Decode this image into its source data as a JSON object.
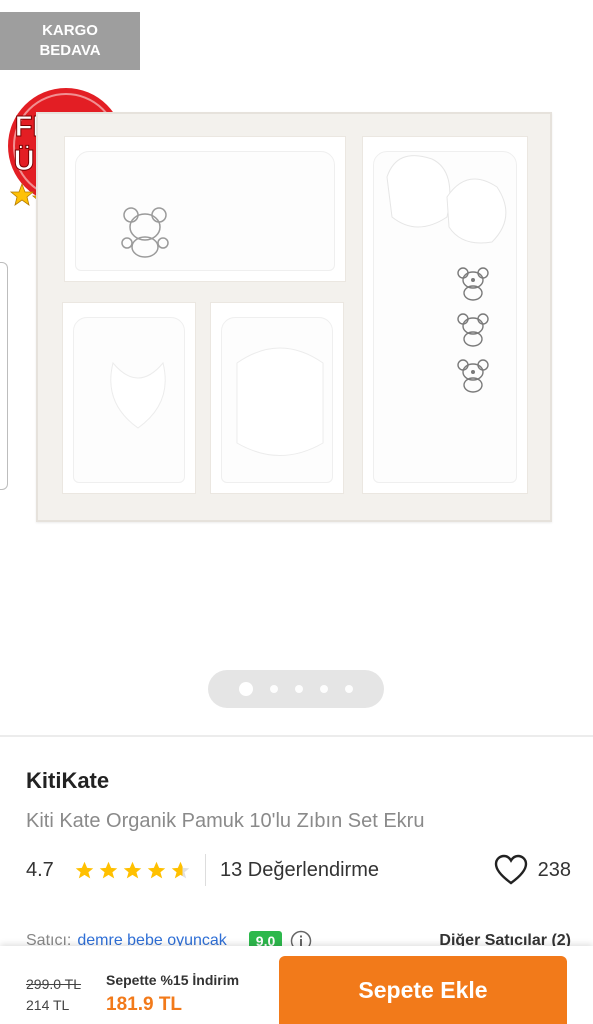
{
  "gallery": {
    "cargo_badge_line1": "KARGO",
    "cargo_badge_line2": "BEDAVA",
    "promo_badge_line1": "FIRSAT",
    "promo_badge_line2": "ÜRÜNÜ",
    "promo_badge_color": "#e31e24",
    "image_count": 5,
    "active_image_index": 0
  },
  "product": {
    "brand": "KitiKate",
    "name": "Kiti Kate Organik Pamuk 10'lu Zıbın Set Ekru",
    "rating": "4.7",
    "rating_value": 4.7,
    "review_count": "13 Değerlendirme",
    "favorite_count": "238"
  },
  "seller": {
    "label": "Satıcı:",
    "name": "demre bebe oyuncak",
    "score": "9.0",
    "other_sellers": "Diğer Satıcılar (2)"
  },
  "pricing": {
    "old_price": "299.0 TL",
    "current_price": "214 TL",
    "campaign_text": "Sepette %15 İndirim",
    "campaign_price": "181.9 TL",
    "add_to_cart_label": "Sepete Ekle",
    "accent_color": "#f27a1a"
  }
}
